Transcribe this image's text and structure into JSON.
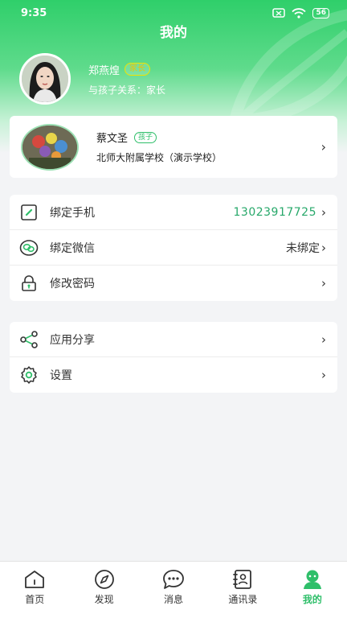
{
  "status_bar": {
    "time": "9:35",
    "battery": "56"
  },
  "header": {
    "title": "我的"
  },
  "profile": {
    "name": "郑燕煌",
    "role_tag": "家长",
    "relation": "与孩子关系：家长"
  },
  "child": {
    "name": "蔡文圣",
    "tag": "孩子",
    "school": "北师大附属学校（演示学校）"
  },
  "account_list": [
    {
      "label": "绑定手机",
      "value": "13023917725",
      "icon": "phone-icon"
    },
    {
      "label": "绑定微信",
      "value": "未绑定",
      "icon": "wechat-icon"
    },
    {
      "label": "修改密码",
      "value": "",
      "icon": "lock-icon"
    }
  ],
  "other_list": [
    {
      "label": "应用分享",
      "icon": "share-icon"
    },
    {
      "label": "设置",
      "icon": "gear-icon"
    }
  ],
  "tabs": [
    {
      "label": "首页",
      "icon": "home-icon"
    },
    {
      "label": "发现",
      "icon": "compass-icon"
    },
    {
      "label": "消息",
      "icon": "message-icon"
    },
    {
      "label": "通讯录",
      "icon": "contacts-icon"
    },
    {
      "label": "我的",
      "icon": "profile-icon",
      "active": true
    }
  ],
  "colors": {
    "accent": "#2fbf6a",
    "phone_value": "#27a86a"
  }
}
